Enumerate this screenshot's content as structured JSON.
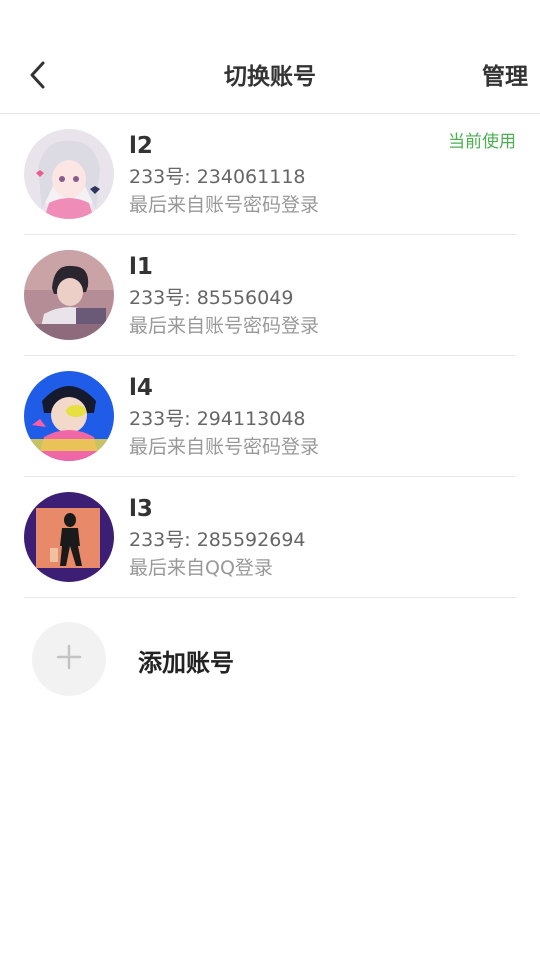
{
  "header": {
    "title": "切换账号",
    "manage_label": "管理"
  },
  "accounts": [
    {
      "name": "l2",
      "id_text": "233号: 234061118",
      "login_text": "最后来自账号密码登录",
      "current_label": "当前使用"
    },
    {
      "name": "l1",
      "id_text": "233号: 85556049",
      "login_text": "最后来自账号密码登录"
    },
    {
      "name": "l4",
      "id_text": "233号: 294113048",
      "login_text": "最后来自账号密码登录"
    },
    {
      "name": "l3",
      "id_text": "233号: 285592694",
      "login_text": "最后来自QQ登录"
    }
  ],
  "add_account": {
    "label": "添加账号"
  },
  "colors": {
    "current_tag": "#4caf50",
    "divider": "#e8e8e8",
    "add_circle": "#f2f2f2"
  },
  "icons": {
    "back": "chevron-left-icon",
    "add": "plus-icon"
  }
}
